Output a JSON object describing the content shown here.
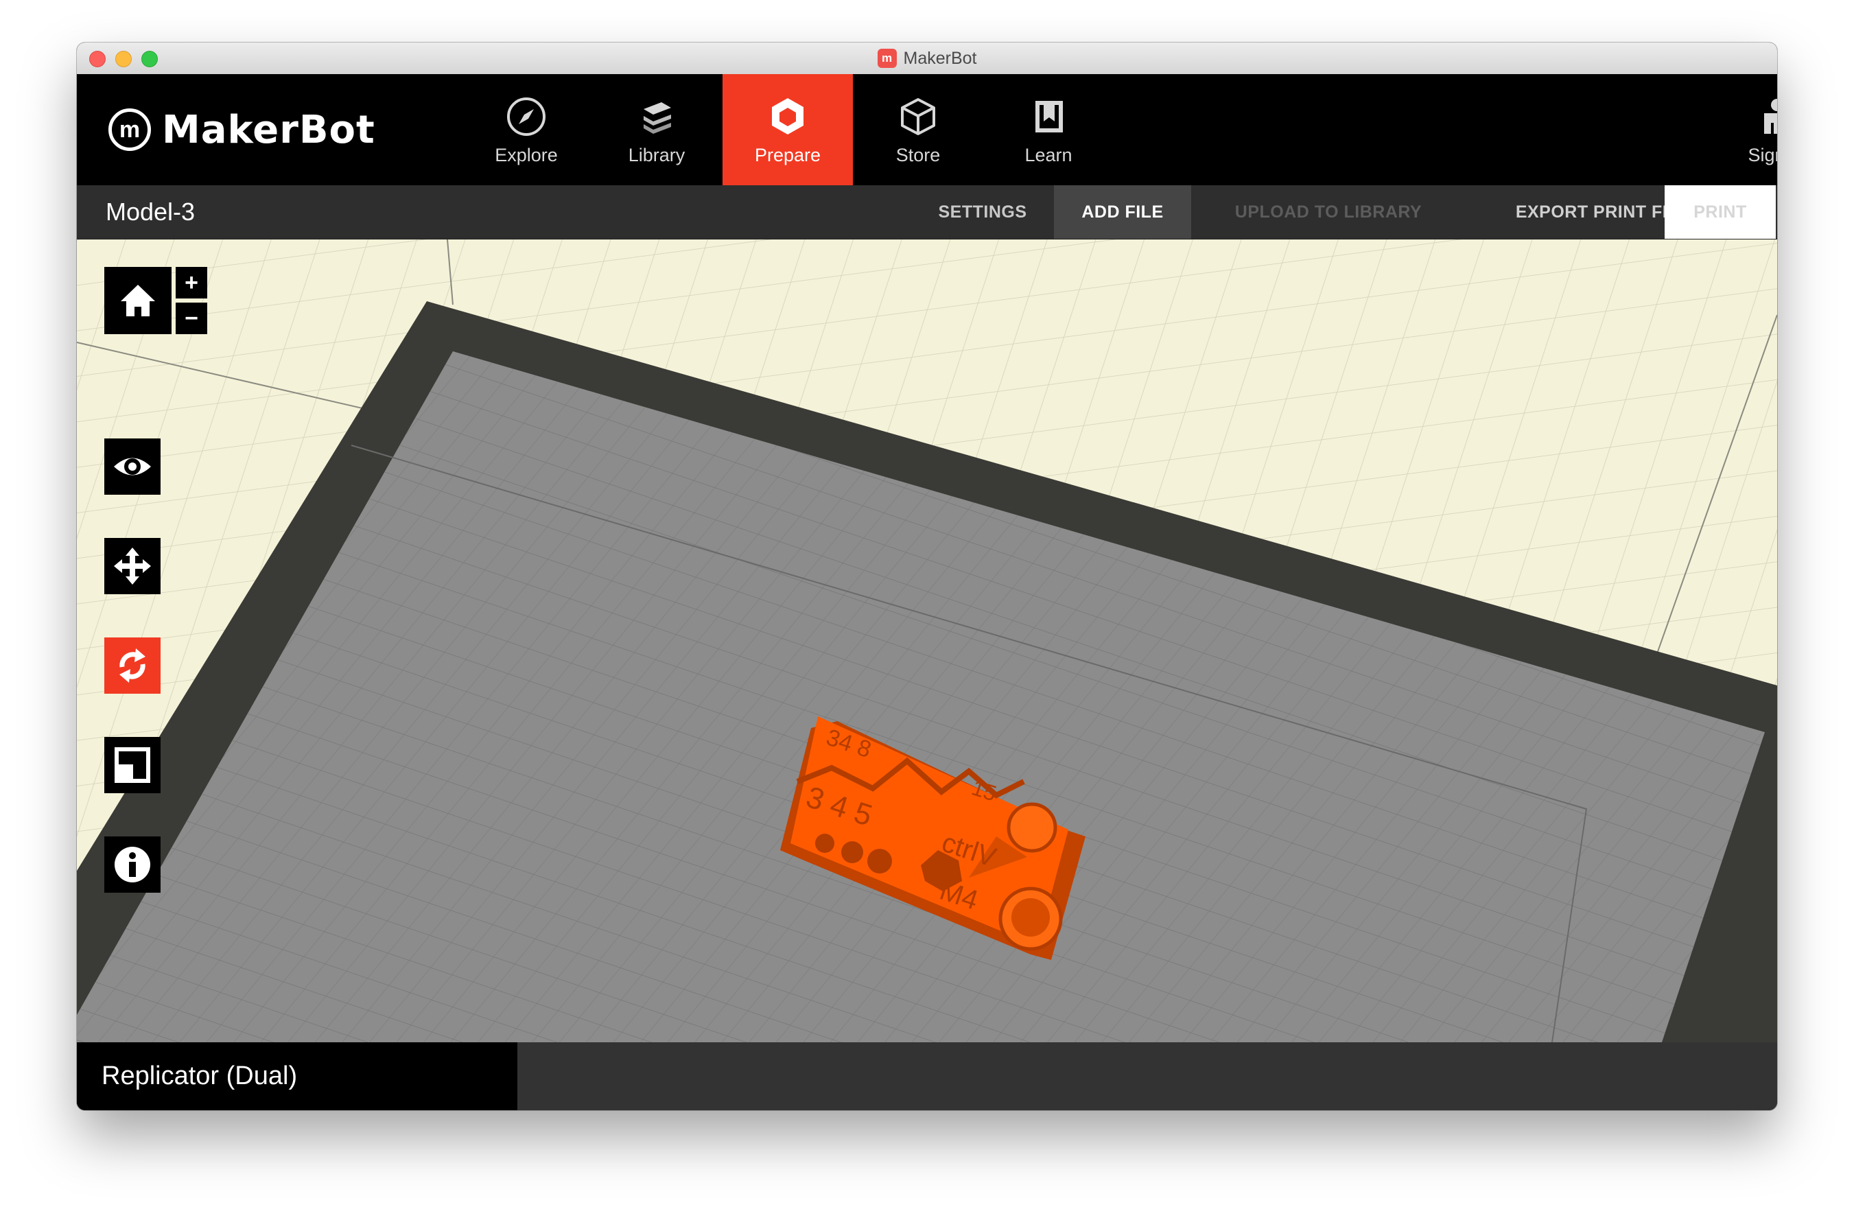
{
  "window": {
    "title": "MakerBot"
  },
  "brand": {
    "logo_letter": "m",
    "logo_text": "MakerBot"
  },
  "nav": {
    "items": [
      {
        "label": "Explore",
        "icon": "compass-icon"
      },
      {
        "label": "Library",
        "icon": "layers-icon"
      },
      {
        "label": "Prepare",
        "icon": "hexagon-icon",
        "active": true
      },
      {
        "label": "Store",
        "icon": "box-icon"
      },
      {
        "label": "Learn",
        "icon": "book-icon"
      }
    ],
    "sign_in": "Sign In"
  },
  "toolbar": {
    "model_name": "Model-3",
    "settings": "SETTINGS",
    "add_file": "ADD FILE",
    "upload": "UPLOAD TO LIBRARY",
    "export": "EXPORT PRINT FILE",
    "print": "PRINT"
  },
  "viewport": {
    "zoom_in": "+",
    "zoom_out": "−",
    "tools": [
      "home-icon",
      "eye-icon",
      "move-icon",
      "rotate-icon",
      "scale-icon",
      "info-icon"
    ],
    "active_tool": "rotate-icon",
    "model_labels": [
      "3 4 5",
      "ctrlV",
      "M4",
      "34 8",
      "15"
    ]
  },
  "status": {
    "printer": "Replicator (Dual)"
  },
  "colors": {
    "accent": "#f23a23",
    "model": "#ff5a00",
    "plate": "#8c8c8c",
    "background": "#f4f2d8"
  }
}
